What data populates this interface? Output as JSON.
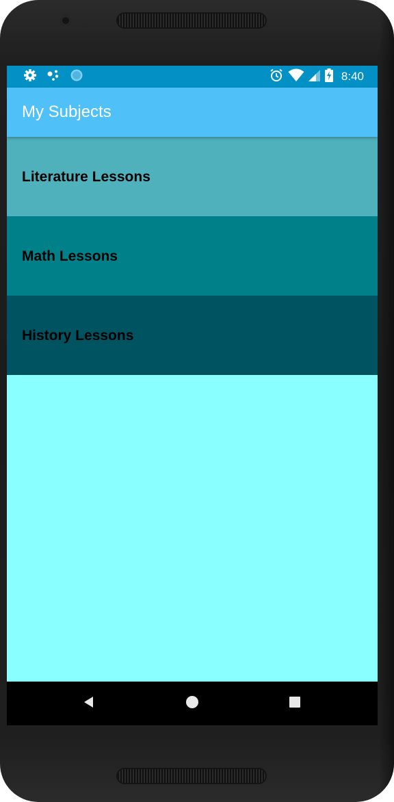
{
  "status_bar": {
    "time": "8:40",
    "left_icons": [
      "settings-gear-icon",
      "dots-icon",
      "circle-icon"
    ],
    "right_icons": [
      "alarm-clock-icon",
      "wifi-icon",
      "signal-icon",
      "battery-charging-icon"
    ]
  },
  "app_bar": {
    "title": "My Subjects"
  },
  "subjects": [
    {
      "label": "Literature Lessons",
      "color": "#4fb1bc"
    },
    {
      "label": "Math Lessons",
      "color": "#00818a"
    },
    {
      "label": "History Lessons",
      "color": "#005462"
    }
  ],
  "colors": {
    "status_bar": "#0290c5",
    "app_bar": "#4fc0f8",
    "background": "#8affff",
    "nav_bar": "#000000"
  },
  "nav_bar": {
    "buttons": [
      "back-triangle-icon",
      "home-circle-icon",
      "recents-square-icon"
    ]
  }
}
